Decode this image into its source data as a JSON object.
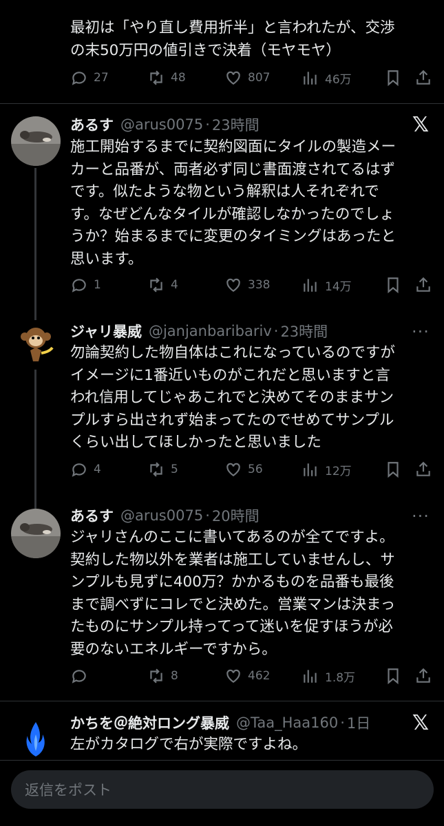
{
  "tweets": [
    {
      "body": "最初は「やり直し費用折半」と言われたが、交渉\nの末50万円の値引きで決着（モヤモヤ）",
      "replies": "27",
      "retweets": "48",
      "likes": "807",
      "views": "46万"
    },
    {
      "name": "あるす",
      "handle": "@arus0075",
      "time": "23時間",
      "body": "施工開始するまでに契約図面にタイルの製造メー\nカーと品番が、両者必ず同じ書面渡されてるはず\nです。似たような物という解釈は人それぞれで\nす。なぜどんなタイルが確認しなかったのでしょ\nうか？始まるまでに変更のタイミングはあったと\n思います。",
      "replies": "1",
      "retweets": "4",
      "likes": "338",
      "views": "14万"
    },
    {
      "name": "ジャリ暴威",
      "handle": "@janjanbaribariv",
      "time": "23時間",
      "body": "勿論契約した物自体はこれになっているのですが\nイメージに1番近いものがこれだと思いますと言\nわれ信用してじゃあこれでと決めてそのままサン\nプルすら出されず始まってたのでせめてサンプル\nくらい出してほしかったと思いました",
      "replies": "4",
      "retweets": "5",
      "likes": "56",
      "views": "12万"
    },
    {
      "name": "あるす",
      "handle": "@arus0075",
      "time": "20時間",
      "body": "ジャリさんのここに書いてあるのが全てですよ。\n契約した物以外を業者は施工していませんし、サ\nンプルも見ずに400万？かかるものを品番も最後\nまで調べずにコレでと決めた。営業マンは決まっ\nたものにサンプル持ってって迷いを促すほうが必\n要のないエネルギーですから。",
      "replies": "",
      "retweets": "8",
      "likes": "462",
      "views": "1.8万"
    },
    {
      "name": "かちを＠絶対ロング暴威",
      "handle": "@Taa_Haa160",
      "time": "1日",
      "body": "左がカタログで右が実際ですよね。"
    }
  ],
  "header_separator": "·",
  "more_icon_glyph": "···",
  "x_logo": "𝕏",
  "reply_placeholder": "返信をポスト",
  "icons": [
    "reply-icon",
    "retweet-icon",
    "like-icon",
    "views-icon",
    "bookmark-icon",
    "share-icon",
    "more-icon",
    "x-logo-icon"
  ],
  "colors": {
    "background": "#000000",
    "text": "#e7e9ea",
    "muted": "#71767b",
    "divider": "#2f3336",
    "input_bg": "#202327"
  }
}
